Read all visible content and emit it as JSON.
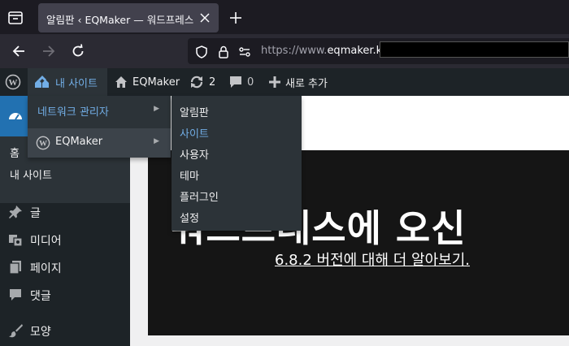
{
  "browser": {
    "tab_title": "알림판 ‹ EQMaker — 워드프레스",
    "url_prefix": "https://www.",
    "url_domain": "eqmaker.kr"
  },
  "admin_bar": {
    "my_sites": "내 사이트",
    "site_name": "EQMaker",
    "updates_count": "2",
    "comments_count": "0",
    "new_label": "새로 추가"
  },
  "my_sites_menu": {
    "network_admin": "네트워크 관리자",
    "site": "EQMaker"
  },
  "network_submenu": [
    "알림판",
    "사이트",
    "사용자",
    "테마",
    "플러그인",
    "설정"
  ],
  "sidebar": {
    "home": "홈",
    "my_sites": "내 사이트",
    "items": [
      "글",
      "미디어",
      "페이지",
      "댓글",
      "모양"
    ]
  },
  "welcome": {
    "title": "워드프레스에 오신",
    "version_link": "6.8.2 버전에 대해 더 알아보기."
  },
  "colors": {
    "accent": "#2271b1",
    "link": "#72aee6",
    "adminbar": "#1d2327"
  }
}
